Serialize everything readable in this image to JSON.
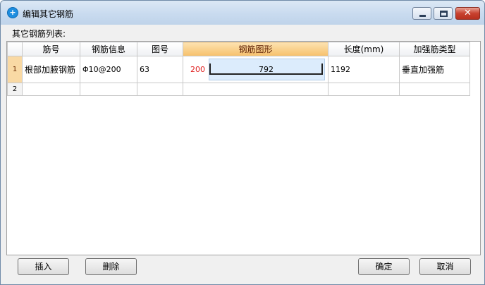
{
  "window": {
    "title": "编辑其它钢筋",
    "close_symbol": "✕"
  },
  "list_label": "其它钢筋列表:",
  "table": {
    "columns": [
      "筋号",
      "钢筋信息",
      "图号",
      "钢筋图形",
      "长度(mm)",
      "加强筋类型"
    ],
    "rows": [
      {
        "num": "1",
        "name": "根部加腋钢筋",
        "info": "Φ10@200",
        "fig": "63",
        "shape_left": "200",
        "shape_mid": "792",
        "length": "1192",
        "type": "垂直加强筋"
      },
      {
        "num": "2",
        "name": "",
        "info": "",
        "fig": "",
        "shape_left": "",
        "shape_mid": "",
        "length": "",
        "type": ""
      }
    ]
  },
  "buttons": {
    "insert": "插入",
    "delete": "删除",
    "ok": "确定",
    "cancel": "取消"
  }
}
